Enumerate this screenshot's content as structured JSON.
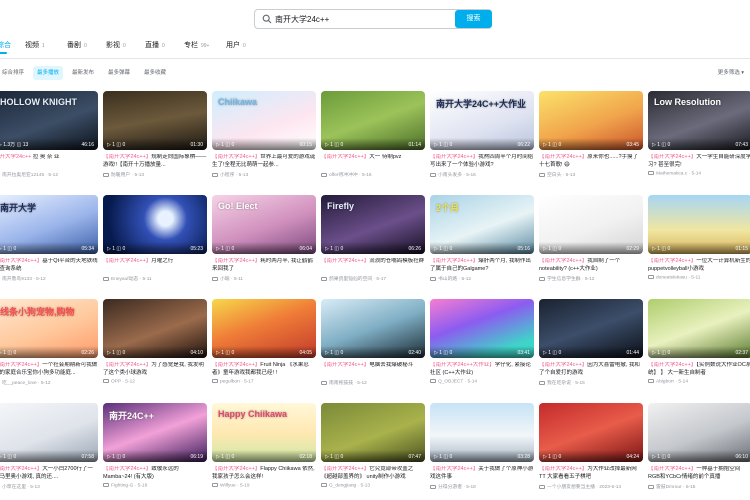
{
  "search": {
    "query": "南开大学24c++",
    "button_label": "搜索"
  },
  "tabs": [
    {
      "label": "综合",
      "count": ""
    },
    {
      "label": "视频",
      "count": "1"
    },
    {
      "label": "番剧",
      "count": "0"
    },
    {
      "label": "影视",
      "count": "0"
    },
    {
      "label": "直播",
      "count": "0"
    },
    {
      "label": "专栏",
      "count": "99+"
    },
    {
      "label": "用户",
      "count": "0"
    }
  ],
  "filters": [
    "综合排序",
    "最多播放",
    "最新发布",
    "最多弹幕",
    "最多收藏"
  ],
  "sort_label": "更多筛选",
  "colors": {
    "accent": "#00aeec",
    "highlight": "#f25d8e"
  },
  "cards": [
    {
      "stat": "▷ 1.3万 ◫ 13",
      "dur": "46:16",
      "hl": "南开大学24c++",
      "title": " 拉 奥 奈 亚",
      "meta": "南开拉奥尼亚12145 · 5-12",
      "cap": "HOLLOW KNIGHT",
      "bg": "linear-gradient(160deg,#1c2738,#3c4e66 55%,#0d131c)",
      "capc": "#e7eef7"
    },
    {
      "stat": "▷ 1 ◫ 0",
      "dur": "01:30",
      "hl": "【南开大学24c++】",
      "title": "规制走向国际象棋——游戏!!【南开十万播放量...",
      "meta": "防暖用户 · 5-13",
      "cap": "",
      "bg": "linear-gradient(170deg,#3a2f1e,#6d5a3c 50%,#1c1812)",
      "capc": "#fff"
    },
    {
      "stat": "▷ 1 ◫ 0",
      "dur": "00:15",
      "hl": "【南开大学24c++】",
      "title": "世界上最可爱的游戏诞生了!全程无比萌萌一起参...",
      "meta": "小程序 · 5-13",
      "cap": "Chiikawa",
      "bg": "linear-gradient(160deg,#cfeeff,#fde6f0 60%,#ffffff)",
      "capc": "#6bb7e6"
    },
    {
      "stat": "▷ 1 ◫ 0",
      "dur": "01:14",
      "hl": "【南开大学24c++】",
      "title": "大一 待制pvz",
      "meta": "offer待冲冲冲 · 5-16",
      "cap": "",
      "bg": "linear-gradient(160deg,#6b9b3a,#9cc35a 50%,#4c6e2a)",
      "capc": "#fff"
    },
    {
      "stat": "▷ 1 ◫ 0",
      "dur": "06:22",
      "hl": "【南开大学24c++】",
      "title": "我熬四周半个月时间给写出来了一个体验小游戏?",
      "meta": "小南头发多 · 5-16",
      "cap": "南开大学24C++大作业",
      "bg": "linear-gradient(160deg,#ffffff,#dfe3f1 60%,#b9c4dd)",
      "capc": "#1b2a55"
    },
    {
      "stat": "▷ 1 ◫ 0",
      "dur": "03:45",
      "hl": "【南开大学24c++】",
      "title": "原来你也......?手摸了十七首歌! 😄",
      "meta": "空白头 · 5-13",
      "cap": "",
      "bg": "linear-gradient(160deg,#fbe26a,#f1a44c 55%,#c8542c)",
      "capc": "#fff"
    },
    {
      "stat": "▷ 1 ◫ 0",
      "dur": "07:43",
      "hl": "【南开大学24c++】",
      "title": "大一学生自能研深度学习? 甚至很完!",
      "meta": "Mathematica.c · 5-14",
      "cap": "Low Resolution",
      "bg": "linear-gradient(160deg,#2b2b33,#6b6b7c 55%,#1a1a20)",
      "capc": "#fff"
    },
    {
      "stat": "▷ 1 ◫ 0",
      "dur": "05:34",
      "hl": "【南开大学24c++】",
      "title": "基于Qt平台的天地铁线路查询系统",
      "meta": "南开鲁鸟9133 · 5-12",
      "cap": "南开大学",
      "bg": "linear-gradient(160deg,#e8f0ff,#9ab4ea 55%,#3c5fa8)",
      "capc": "#1a2a55"
    },
    {
      "stat": "▷ 1 ◫ 0",
      "dur": "05:23",
      "hl": "【南开大学24c++】",
      "title": "月曜之行",
      "meta": "Eneyauf动态 · 5-11",
      "cap": "",
      "bg": "radial-gradient(circle at 60% 40%,#e8f2ff 0 10%,#3250b6 30%,#071a4d 80%)",
      "capc": "#fff"
    },
    {
      "stat": "▷ 1 ◫ 0",
      "dur": "06:04",
      "hl": "【南开大学24c++】",
      "title": "耗时两月半, 我让鹤鹤来回我了",
      "meta": "小瑜 · 5-11",
      "cap": "Go! Elect",
      "bg": "linear-gradient(160deg,#f7d3e7,#cf8fbd 55%,#7a4a7e)",
      "capc": "#fff"
    },
    {
      "stat": "▷ 1 ◫ 0",
      "dur": "06:26",
      "hl": "【南开大学24c++】",
      "title": "流浪的苍嘴鸽模板社群",
      "meta": "鸽果鸽里铠仙的空间 · 5-17",
      "cap": "Firefly",
      "bg": "linear-gradient(160deg,#241b3a,#6b4f8a 55%,#160f24)",
      "capc": "#e6f2ff"
    },
    {
      "stat": "▷ 1 ◫ 0",
      "dur": "05:16",
      "hl": "【南开大学24c++】",
      "title": "爆肝两个月, 我制作出了属于自己的Galgame?",
      "meta": "书山的路 · 5-12",
      "cap": "2个月",
      "bg": "linear-gradient(160deg,#a9d3e6,#e8f4f6 55%,#5b8ba3)",
      "capc": "#f7e341"
    },
    {
      "stat": "▷ 1 ◫ 0",
      "dur": "02:29",
      "hl": "【南开大学24c++】",
      "title": "我自制了一个noteability? (c++大作业)",
      "meta": "学生信息学生群 · 5-12",
      "cap": "",
      "bg": "linear-gradient(160deg,#ffffff,#f1f1f1 55%,#d4d4d4)",
      "capc": "#333"
    },
    {
      "stat": "▷ 1 ◫ 0",
      "dur": "01:15",
      "hl": "【南开大学24c++】",
      "title": "一位大一计算机新生的puppetvolleyball小游戏",
      "meta": "doneatsletiasu · 5-11",
      "cap": "",
      "bg": "linear-gradient(180deg,#a6d6f4,#f1e6a0 60%,#d6b35c)",
      "capc": "#fff"
    },
    {
      "stat": "▷ 1 ◫ 0",
      "dur": "02:26",
      "hl": "【南开大学24c++】",
      "title": "一个社会期期新可我做做的家庭合乐宝你小狗多功能庭...",
      "meta": "吃__peace_love · 5-12",
      "cap": "线条小狗宠物,购物",
      "bg": "linear-gradient(160deg,#ffe9d2,#ffc79a 55%,#ff9a6a)",
      "capc": "#ff4b4b"
    },
    {
      "stat": "▷ 1 ◫ 0",
      "dur": "04:10",
      "hl": "【南开大学24c++】",
      "title": "为了感觉是我, 我发明了这个类小球游戏",
      "meta": "OPP · 5-12",
      "cap": "",
      "bg": "linear-gradient(160deg,#3b2a20,#9b6b4c 55%,#1f120c)",
      "capc": "#ff3030"
    },
    {
      "stat": "▷ 1 ◫ 0",
      "dur": "04:05",
      "hl": "【南开大学24c++】",
      "title": "Fruit Ninja 《水果忍者》童年游戏我都我已经! !",
      "meta": "pegulbon · 5-17",
      "cap": "",
      "bg": "linear-gradient(160deg,#f7d84a,#ef7c38 45%,#c23a2a)",
      "capc": "#fff"
    },
    {
      "stat": "▷ 1 ◫ 0",
      "dur": "02:40",
      "hl": "【南开大学24c++】",
      "title": "电脑去我爆破秘斗",
      "meta": "南南拖鼓鼓 · 5-12",
      "cap": "",
      "bg": "linear-gradient(160deg,#d8ecf7,#7faec4 50%,#1a2b34)",
      "capc": "#fff"
    },
    {
      "stat": "▷ 1 ◫ 0",
      "dur": "03:41",
      "hl": "【南开大学24c++大作业】",
      "title": "学仔化, 紧接论社区 (C++大作业)",
      "meta": "Q_OBJECT · 5-14",
      "cap": "",
      "bg": "linear-gradient(160deg,#f77dd1,#8c5cf0 40%,#3fd4c9 80%)",
      "capc": "#fff"
    },
    {
      "stat": "▷ 1 ◫ 0",
      "dur": "01:44",
      "hl": "【南开大学24c++】",
      "title": "因为大喜雷电撤, 我和了个自爱打的游戏",
      "meta": "我在吃杂说 · 5-15",
      "cap": "",
      "bg": "linear-gradient(160deg,#1a2230,#3c4e6a 50%,#0b0f16)",
      "capc": "#fff"
    },
    {
      "stat": "▷ 1 ◫ 0",
      "dur": "02:37",
      "hl": "【南开大学24c++】",
      "title": "【实例数说大作业OC系统】 】 大一新生自制者",
      "meta": "Abigborr · 5-14",
      "cap": "",
      "bg": "linear-gradient(160deg,#aecd6c,#e9f1bf 50%,#5b7b2e)",
      "capc": "#fff"
    },
    {
      "stat": "▷ 1 ◫ 0",
      "dur": "07:58",
      "hl": "【南开大学24c++】",
      "title": "大一小白2700行了一个马里奥小游戏, 真的还....",
      "meta": "小草在这里 · 5-13",
      "cap": "",
      "bg": "linear-gradient(160deg,#f5f7fa,#dfe3ea 55%,#9aa6b4)",
      "capc": "#333"
    },
    {
      "stat": "▷ 1 ◫ 0",
      "dur": "06:19",
      "hl": "【南开大学24c++】",
      "title": "致敬永远的Mamba~24! (有大版)",
      "meta": "Fighting-G · 5-18",
      "cap": "南开24C++",
      "bg": "linear-gradient(160deg,#5a2f7a,#f2a1d8 50%,#3b1c5a)",
      "capc": "#fff"
    },
    {
      "stat": "▷ 1 ◫ 0",
      "dur": "02:18",
      "hl": "【南开大学24c++】",
      "title": "Flappy Chiikawa 依然, 我家孩子怎么会这样!",
      "meta": "Wilfyue · 5-19",
      "cap": "Happy Chiikawa",
      "bg": "linear-gradient(180deg,#fff8d8,#ffe8b2 50%,#cfe8a6)",
      "capc": "#e2466d"
    },
    {
      "stat": "▷ 1 ◫ 0",
      "dur": "07:47",
      "hl": "【南开大学24c++】",
      "title": "它究竟部带攻盖之 《超越部盖界的》 unity制作小游戏",
      "meta": "G_dengjiang · 5-13",
      "cap": "",
      "bg": "linear-gradient(160deg,#7c8a38,#a9b24c 55%,#4a5120)",
      "capc": "#fff"
    },
    {
      "stat": "▷ 1 ◫ 0",
      "dur": "03:28",
      "hl": "【南开大学24c++】",
      "title": "关于我做了个原神小游戏这件事",
      "meta": "分得分游者 · 5-18",
      "cap": "",
      "bg": "linear-gradient(180deg,#c6e3f5,#f2f6f9 55%,#a7b6c4)",
      "capc": "#fff"
    },
    {
      "stat": "▷ 1 ◫ 0",
      "dur": "04:24",
      "hl": "【南开大学24c++】",
      "title": "为大作业改掉最新网TT 大家看看五子棋吧",
      "meta": "一个小朋友想要当主播 · 2023-5-14",
      "cap": "",
      "bg": "linear-gradient(160deg,#c42b2b,#e85c4a 50%,#7a1414)",
      "capc": "#fff34b"
    },
    {
      "stat": "▷ 1 ◫ 0",
      "dur": "06:10",
      "hl": "【南开大学24c++】",
      "title": "一种基于拥抱空间RGB和YCbCr情绪的前个真播",
      "meta": "雷鼓Dmrour · 5-15",
      "cap": "",
      "bg": "linear-gradient(160deg,#f1f1f1,#c4c7cc 55%,#6a6e75)",
      "capc": "#fff"
    }
  ]
}
